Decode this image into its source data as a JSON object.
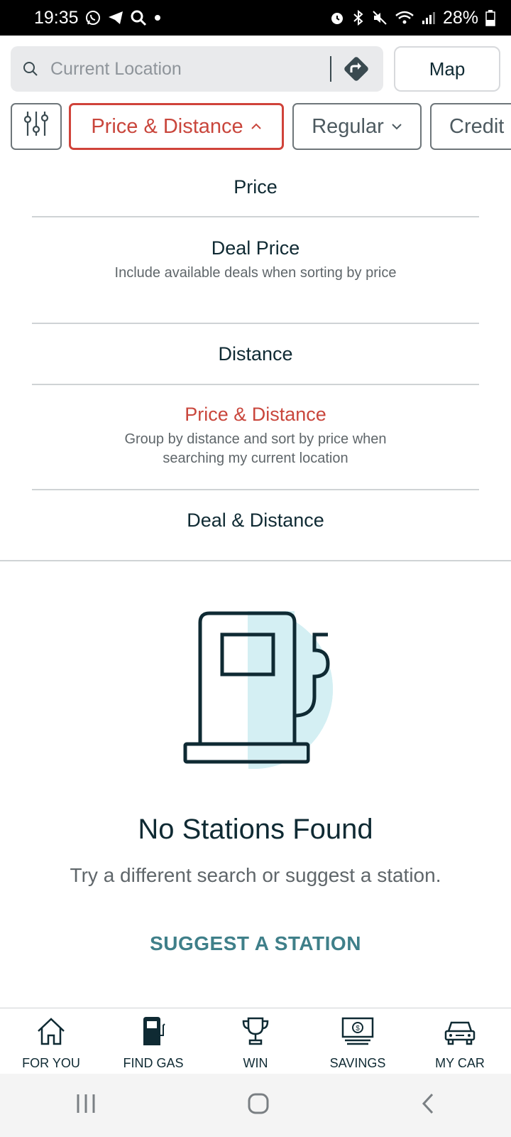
{
  "status_bar": {
    "time": "19:35",
    "battery": "28%"
  },
  "search": {
    "placeholder": "Current Location",
    "map_label": "Map"
  },
  "filters": {
    "sort_label": "Price & Distance",
    "grade_label": "Regular",
    "payment_label": "Credit"
  },
  "sort_options": [
    {
      "title": "Price",
      "desc": ""
    },
    {
      "title": "Deal Price",
      "desc": "Include available deals when sorting by price"
    },
    {
      "title": "Distance",
      "desc": ""
    },
    {
      "title": "Price & Distance",
      "desc": "Group by distance and sort by price when searching my current location"
    },
    {
      "title": "Deal & Distance",
      "desc": ""
    }
  ],
  "selected_sort": "Price & Distance",
  "empty_state": {
    "title": "No Stations Found",
    "subtitle": "Try a different search or suggest a station.",
    "action": "SUGGEST A STATION"
  },
  "bottom_nav": [
    {
      "label": "FOR YOU",
      "icon": "house-icon"
    },
    {
      "label": "FIND GAS",
      "icon": "gas-pump-icon"
    },
    {
      "label": "WIN",
      "icon": "trophy-icon"
    },
    {
      "label": "SAVINGS",
      "icon": "dollar-bill-icon"
    },
    {
      "label": "MY CAR",
      "icon": "car-icon"
    }
  ],
  "colors": {
    "accent_red": "#c9463c",
    "teal": "#3f7f89",
    "dark": "#0f2a33",
    "pump_circle": "#d4eff3"
  }
}
